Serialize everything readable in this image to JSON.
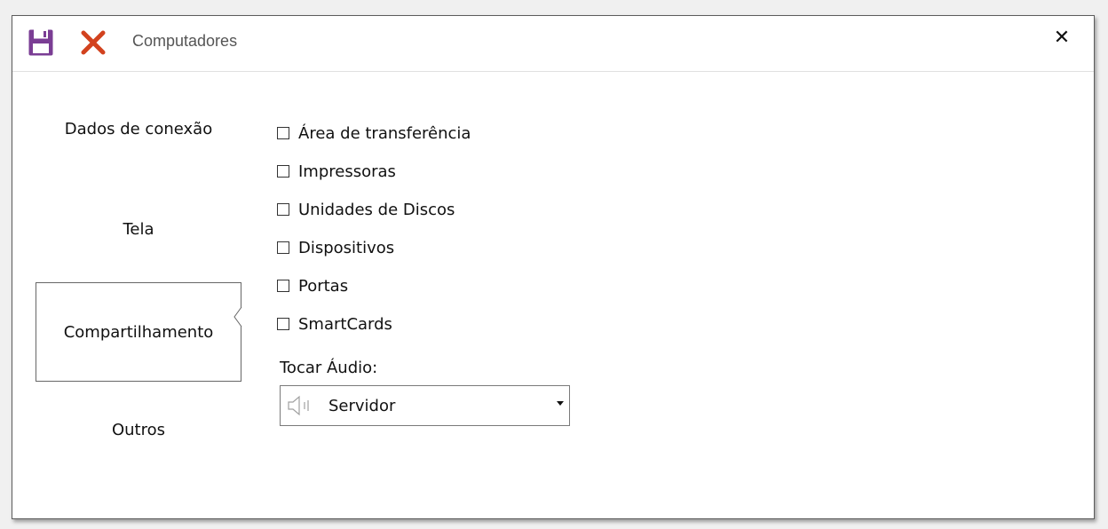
{
  "titlebar": {
    "title": "Computadores",
    "save_icon": "save-icon",
    "cancel_icon": "cancel-icon",
    "close_glyph": "✕",
    "colors": {
      "save": "#7a3d94",
      "cancel": "#d2421e"
    }
  },
  "nav": {
    "items": [
      {
        "label": "Dados de conexão",
        "selected": false
      },
      {
        "label": "Tela",
        "selected": false
      },
      {
        "label": "Compartilhamento",
        "selected": true
      },
      {
        "label": "Outros",
        "selected": false
      }
    ]
  },
  "sharing": {
    "options": [
      {
        "label": "Área de transferência",
        "checked": false
      },
      {
        "label": "Impressoras",
        "checked": false
      },
      {
        "label": "Unidades de Discos",
        "checked": false
      },
      {
        "label": "Dispositivos",
        "checked": false
      },
      {
        "label": "Portas",
        "checked": false
      },
      {
        "label": "SmartCards",
        "checked": false
      }
    ],
    "audio_label": "Tocar Áudio:",
    "audio_value": "Servidor",
    "audio_icon": "speaker-icon"
  }
}
